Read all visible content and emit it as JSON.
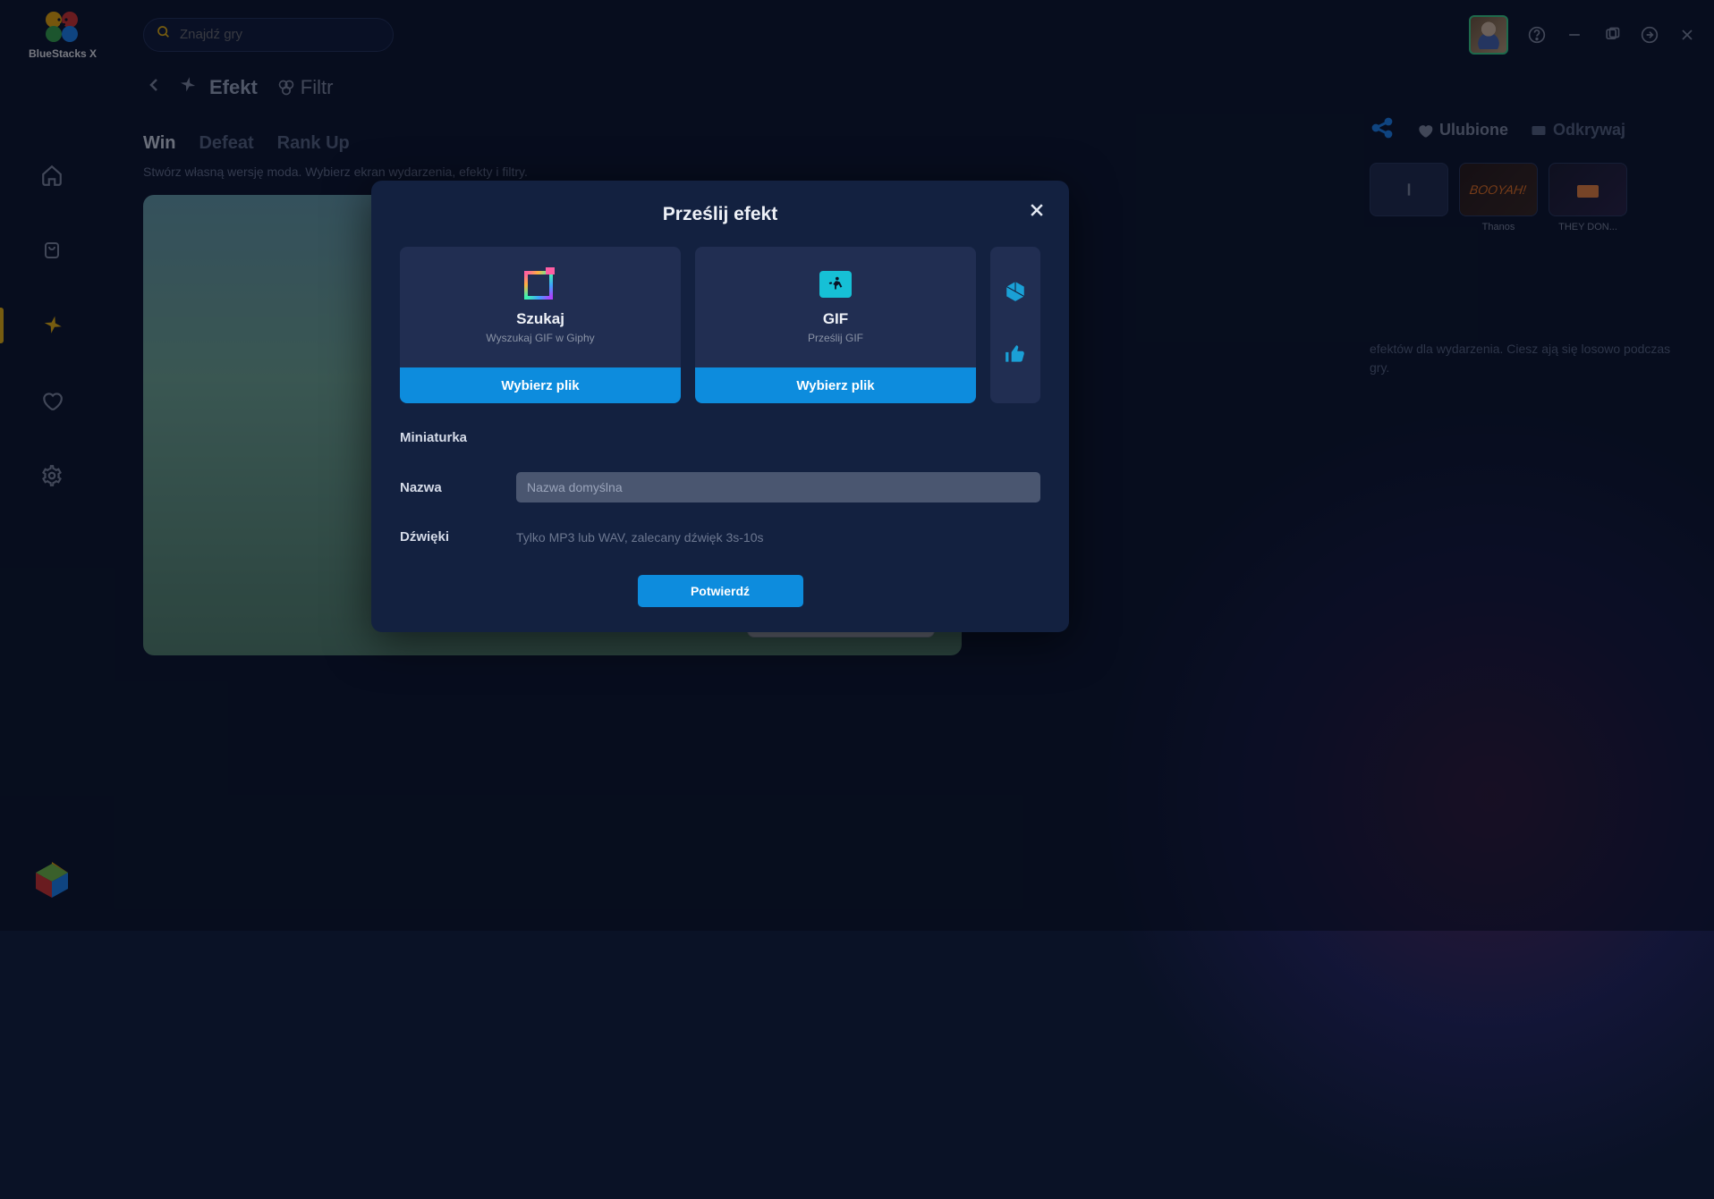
{
  "brand": "BlueStacks X",
  "search": {
    "placeholder": "Znajdź gry"
  },
  "page": {
    "title": "Efekt",
    "filter": "Filtr",
    "tabs": [
      "Win",
      "Defeat",
      "Rank Up"
    ],
    "active_tab": 0,
    "subhead": "Stwórz własną wersję moda. Wybierz ekran wydarzenia, efekty i filtry."
  },
  "right": {
    "favorites": "Ulubione",
    "discover": "Odkrywaj",
    "cards": [
      {
        "label": ""
      },
      {
        "label": "Thanos"
      },
      {
        "label": "THEY DON..."
      }
    ],
    "desc_tail": "efektów dla wydarzenia. Ciesz ają się losowo podczas gry."
  },
  "modal": {
    "title": "Prześlij efekt",
    "search_card": {
      "title": "Szukaj",
      "sub": "Wyszukaj GIF w Giphy",
      "btn": "Wybierz plik"
    },
    "gif_card": {
      "title": "GIF",
      "sub": "Prześlij GIF",
      "btn": "Wybierz plik"
    },
    "thumbnail_label": "Miniaturka",
    "name_label": "Nazwa",
    "name_placeholder": "Nazwa domyślna",
    "sounds_label": "Dźwięki",
    "sounds_hint": "Tylko MP3 lub WAV, zalecany dźwięk 3s-10s",
    "confirm": "Potwierdź"
  }
}
